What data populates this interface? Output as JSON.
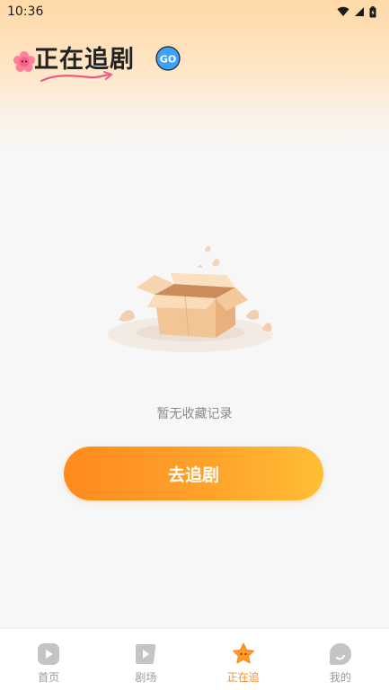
{
  "status_bar": {
    "time": "10:36"
  },
  "header": {
    "title": "正在追剧",
    "badge": "GO"
  },
  "empty_state": {
    "message": "暂无收藏记录"
  },
  "cta": {
    "label": "去追剧"
  },
  "tabs": [
    {
      "label": "首页",
      "icon": "play-icon",
      "active": false
    },
    {
      "label": "剧场",
      "icon": "theater-icon",
      "active": false
    },
    {
      "label": "正在追",
      "icon": "star-icon",
      "active": true
    },
    {
      "label": "我的",
      "icon": "profile-icon",
      "active": false
    }
  ],
  "colors": {
    "accent": "#ff8a1e",
    "accent_end": "#ffbe36",
    "inactive": "#9a9a9a"
  }
}
